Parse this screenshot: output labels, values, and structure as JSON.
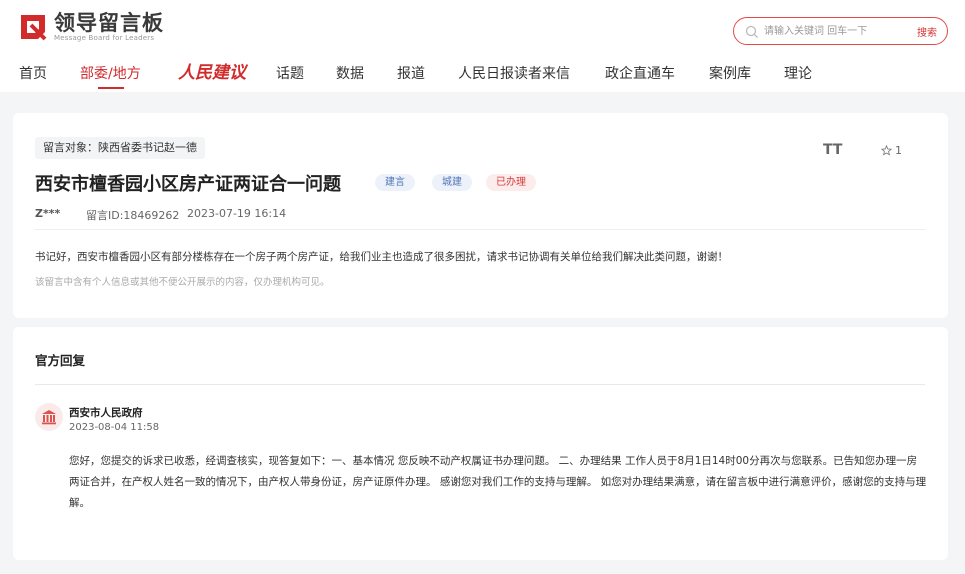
{
  "header": {
    "logo_cn": "领导留言板",
    "logo_en": "Message Board for Leaders",
    "search_placeholder": "请输入关键词 回车一下",
    "search_button": "搜索"
  },
  "nav": {
    "items": [
      "首页",
      "部委/地方",
      "人民建议",
      "话题",
      "数据",
      "报道",
      "人民日报读者来信",
      "政企直通车",
      "案例库",
      "理论"
    ],
    "active_index": 1
  },
  "message": {
    "target": "留言对象：陕西省委书记赵一德",
    "title": "西安市檀香园小区房产证两证合一问题",
    "tags": [
      "建言",
      "城建",
      "已办理"
    ],
    "author": "Z***",
    "id_label": "留言ID:18469262",
    "datetime": "2023-07-19 16:14",
    "favorite_count": "1",
    "text_size_label": "TT",
    "body": "书记好，西安市檀香园小区有部分楼栋存在一个房子两个房产证，给我们业主也造成了很多困扰，请求书记协调有关单位给我们解决此类问题，谢谢！",
    "notice": "该留言中含有个人信息或其他不便公开展示的内容，仅办理机构可见。"
  },
  "reply": {
    "heading": "官方回复",
    "org": "西安市人民政府",
    "datetime": "2023-08-04 11:58",
    "text": "您好，您提交的诉求已收悉，经调查核实，现答复如下：一、基本情况 您反映不动产权属证书办理问题。 二、办理结果 工作人员于8月1日14时00分再次与您联系。已告知您办理一房两证合并，在产权人姓名一致的情况下，由产权人带身份证，房产证原件办理。 感谢您对我们工作的支持与理解。 如您对办理结果满意，请在留言板中进行满意评价，感谢您的支持与理解。"
  },
  "colors": {
    "brand_red": "#d22b2b",
    "tag_blue_bg": "#edf2fa",
    "tag_red_bg": "#fdecec"
  }
}
